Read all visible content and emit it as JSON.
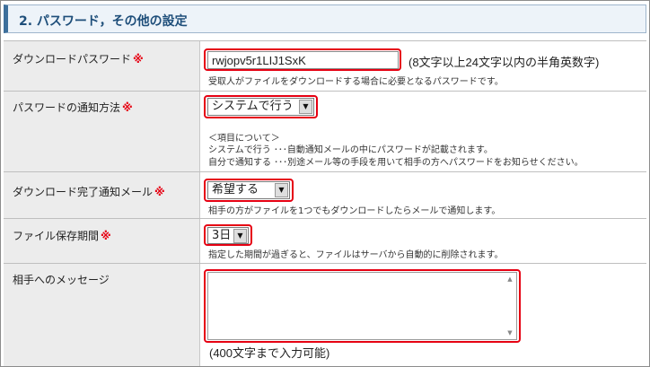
{
  "section": {
    "title": "2. パスワード，その他の設定"
  },
  "required_mark": "※",
  "download_password": {
    "label": "ダウンロードパスワード",
    "value": "rwjopv5r1LIJ1SxK",
    "note": "(8文字以上24文字以内の半角英数字)",
    "hint": "受取人がファイルをダウンロードする場合に必要となるパスワードです。"
  },
  "password_notify": {
    "label": "パスワードの通知方法",
    "selected": "システムで行う",
    "info_title": "＜項目について＞",
    "info_line1": "システムで行う ･･･自動通知メールの中にパスワードが記載されます。",
    "info_line2": "自分で通知する ･･･別途メール等の手段を用いて相手の方へパスワードをお知らせください。"
  },
  "download_complete_mail": {
    "label": "ダウンロード完了通知メール",
    "selected": "希望する",
    "hint": "相手の方がファイルを1つでもダウンロードしたらメールで通知します。"
  },
  "retention": {
    "label": "ファイル保存期間",
    "selected": "3日",
    "hint": "指定した期間が過ぎると、ファイルはサーバから自動的に削除されます。"
  },
  "message": {
    "label": "相手へのメッセージ",
    "note": "(400文字まで入力可能)"
  },
  "colors": {
    "highlight": "#e60012",
    "header_accent": "#3d6f9b",
    "label_bg": "#ececec"
  }
}
